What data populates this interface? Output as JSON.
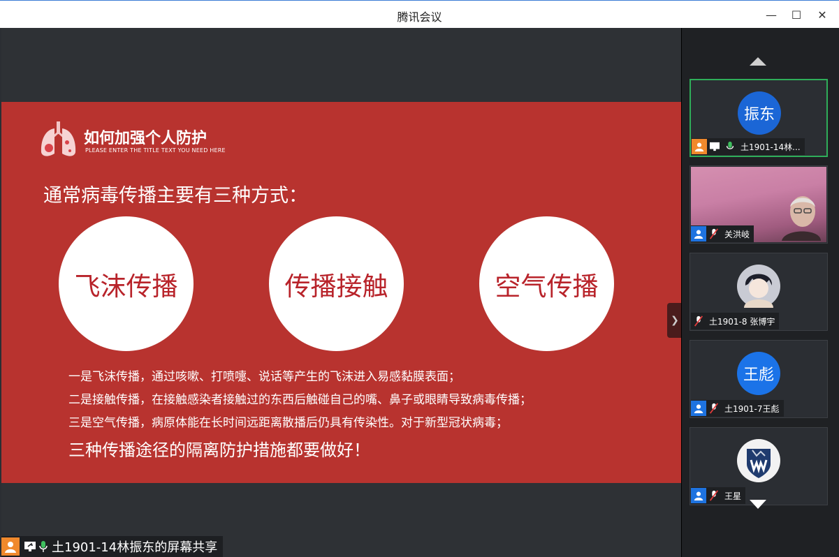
{
  "window": {
    "title": "腾讯会议",
    "controls": {
      "minimize": "—",
      "maximize": "☐",
      "close": "✕"
    }
  },
  "slide": {
    "title": "如何加强个人防护",
    "subtitle": "PLEASE ENTER THE TITLE TEXT YOU NEED HERE",
    "heading": "通常病毒传播主要有三种方式：",
    "circles": [
      "飞沫传播",
      "传播接触",
      "空气传播"
    ],
    "lines": [
      "一是飞沫传播，通过咳嗽、打喷嚏、说话等产生的飞沫进入易感黏膜表面；",
      "二是接触传播，在接触感染者接触过的东西后触碰自己的嘴、鼻子或眼睛导致病毒传播；",
      "三是空气传播，病原体能在长时间远距离散播后仍具有传染性。对于新型冠状病毒；"
    ],
    "conclusion": "三种传播途径的隔离防护措施都要做好！",
    "colors": {
      "background": "#b8332f",
      "circle_text": "#b8232a"
    }
  },
  "share_label": "土1901-14林振东的屏幕共享",
  "participants": [
    {
      "name": "土1901-14林...",
      "avatar_text": "振东",
      "mic": "on",
      "sharing": true,
      "active": true
    },
    {
      "name": "关洪岐",
      "avatar_text": "",
      "mic": "muted",
      "video": true
    },
    {
      "name": "土1901-8 张博宇",
      "avatar_text": "",
      "mic": "muted",
      "avatar_image": "anime-boy"
    },
    {
      "name": "土1901-7王彪",
      "avatar_text": "王彪",
      "mic": "muted"
    },
    {
      "name": "王星",
      "avatar_text": "",
      "mic": "muted",
      "avatar_image": "wolf-logo"
    }
  ]
}
